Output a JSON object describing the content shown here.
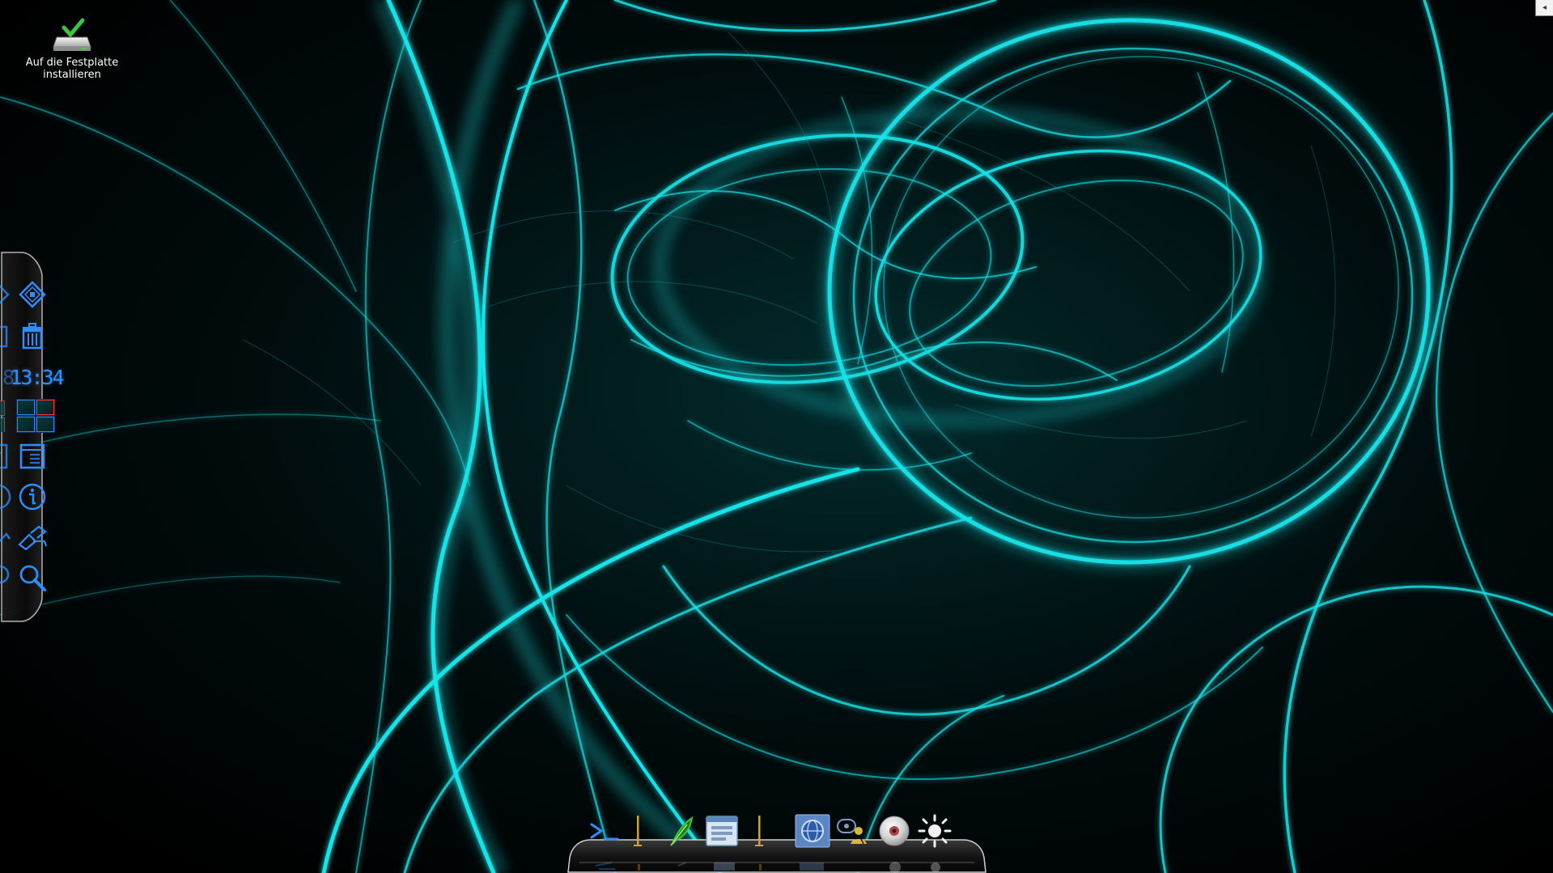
{
  "desktop": {
    "icons": [
      {
        "label_line1": "Auf die Festplatte",
        "label_line2": "installieren",
        "icon": "install-to-disk-icon"
      }
    ]
  },
  "corner_toggle": {
    "glyph": "◂",
    "icon": "collapse-arrow-icon"
  },
  "left_panel": {
    "items": [
      {
        "name": "kickoff-launcher",
        "icon": "launcher-diamond-icon"
      },
      {
        "name": "trash",
        "icon": "trash-icon"
      },
      {
        "name": "clock",
        "icon": "digital-clock-icon"
      },
      {
        "name": "pager",
        "icon": "virtual-desktop-pager-icon",
        "active_workspace": 1
      },
      {
        "name": "desktop-view",
        "icon": "window-list-icon"
      },
      {
        "name": "info",
        "icon": "info-icon"
      },
      {
        "name": "system-settings",
        "icon": "settings-wrench-icon"
      },
      {
        "name": "search",
        "icon": "search-icon"
      }
    ],
    "clock_time": "13:34",
    "clock_ghost": ":8"
  },
  "dock": {
    "items": [
      {
        "name": "terminal",
        "icon": "terminal-icon"
      },
      {
        "name": "separator-1",
        "icon": "separator-icon"
      },
      {
        "name": "text-editor",
        "icon": "quill-pen-icon"
      },
      {
        "name": "file-manager",
        "icon": "file-manager-icon"
      },
      {
        "name": "separator-2",
        "icon": "separator-icon"
      },
      {
        "name": "web-browser",
        "icon": "globe-browser-icon"
      },
      {
        "name": "user-settings",
        "icon": "user-chat-icon"
      },
      {
        "name": "disc-burner",
        "icon": "optical-disc-icon"
      },
      {
        "name": "display-brightness",
        "icon": "sun-brightness-icon"
      }
    ]
  },
  "colors": {
    "background": "#000000",
    "wallpaper_glow": "#19e6ea",
    "panel_icon_blue": "#2d8fff",
    "dock_separator": "#d9a21b"
  }
}
